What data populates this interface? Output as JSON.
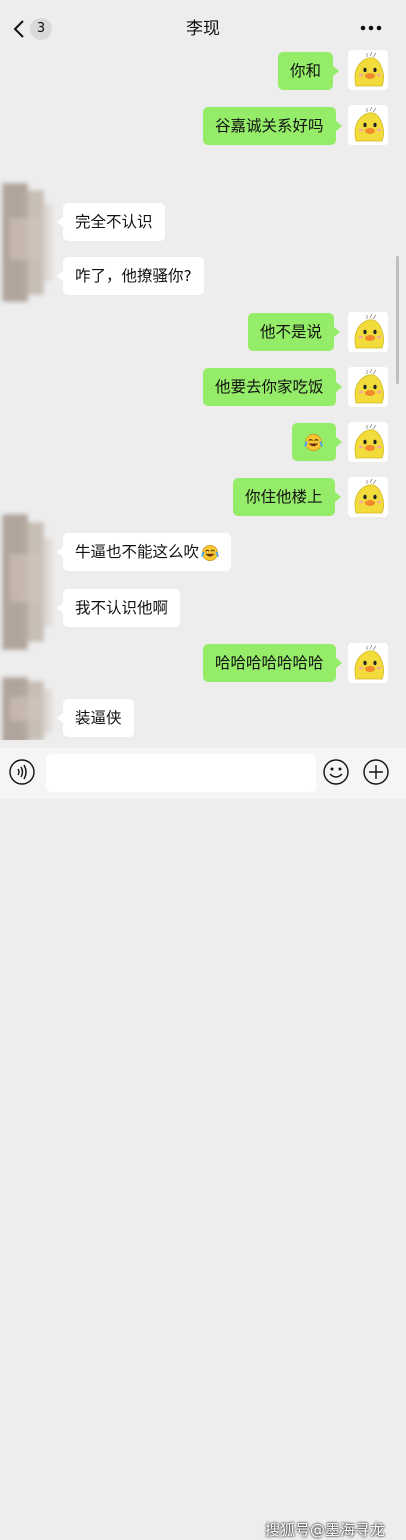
{
  "header": {
    "unread_count": "3",
    "title": "李现"
  },
  "messages": [
    {
      "side": "out",
      "text": "你和"
    },
    {
      "side": "out",
      "text": "谷嘉诚关系好吗"
    },
    {
      "side": "in",
      "text": "完全不认识"
    },
    {
      "side": "in",
      "text": "咋了，他撩骚你?"
    },
    {
      "side": "out",
      "text": "他不是说"
    },
    {
      "side": "out",
      "text": "他要去你家吃饭"
    },
    {
      "side": "out",
      "text": "",
      "emoji": "laugh-cry-emoji"
    },
    {
      "side": "out",
      "text": "你住他楼上"
    },
    {
      "side": "in",
      "text": "牛逼也不能这么吹",
      "emoji": "laugh-cry-emoji"
    },
    {
      "side": "in",
      "text": "我不认识他啊"
    },
    {
      "side": "out",
      "text": "哈哈哈哈哈哈哈"
    },
    {
      "side": "in",
      "text": "装逼侠"
    }
  ],
  "input_bar": {
    "placeholder": ""
  },
  "watermark": "搜狐号@墨海寻龙",
  "colors": {
    "background": "#ededed",
    "outgoing_bubble": "#95ec69",
    "incoming_bubble": "#ffffff",
    "avatar_yellow": "#f2dc3c"
  },
  "icons": [
    "back-chevron-icon",
    "more-icon",
    "voice-icon",
    "emoji-icon",
    "plus-icon",
    "duck-avatar",
    "laugh-cry-emoji"
  ]
}
